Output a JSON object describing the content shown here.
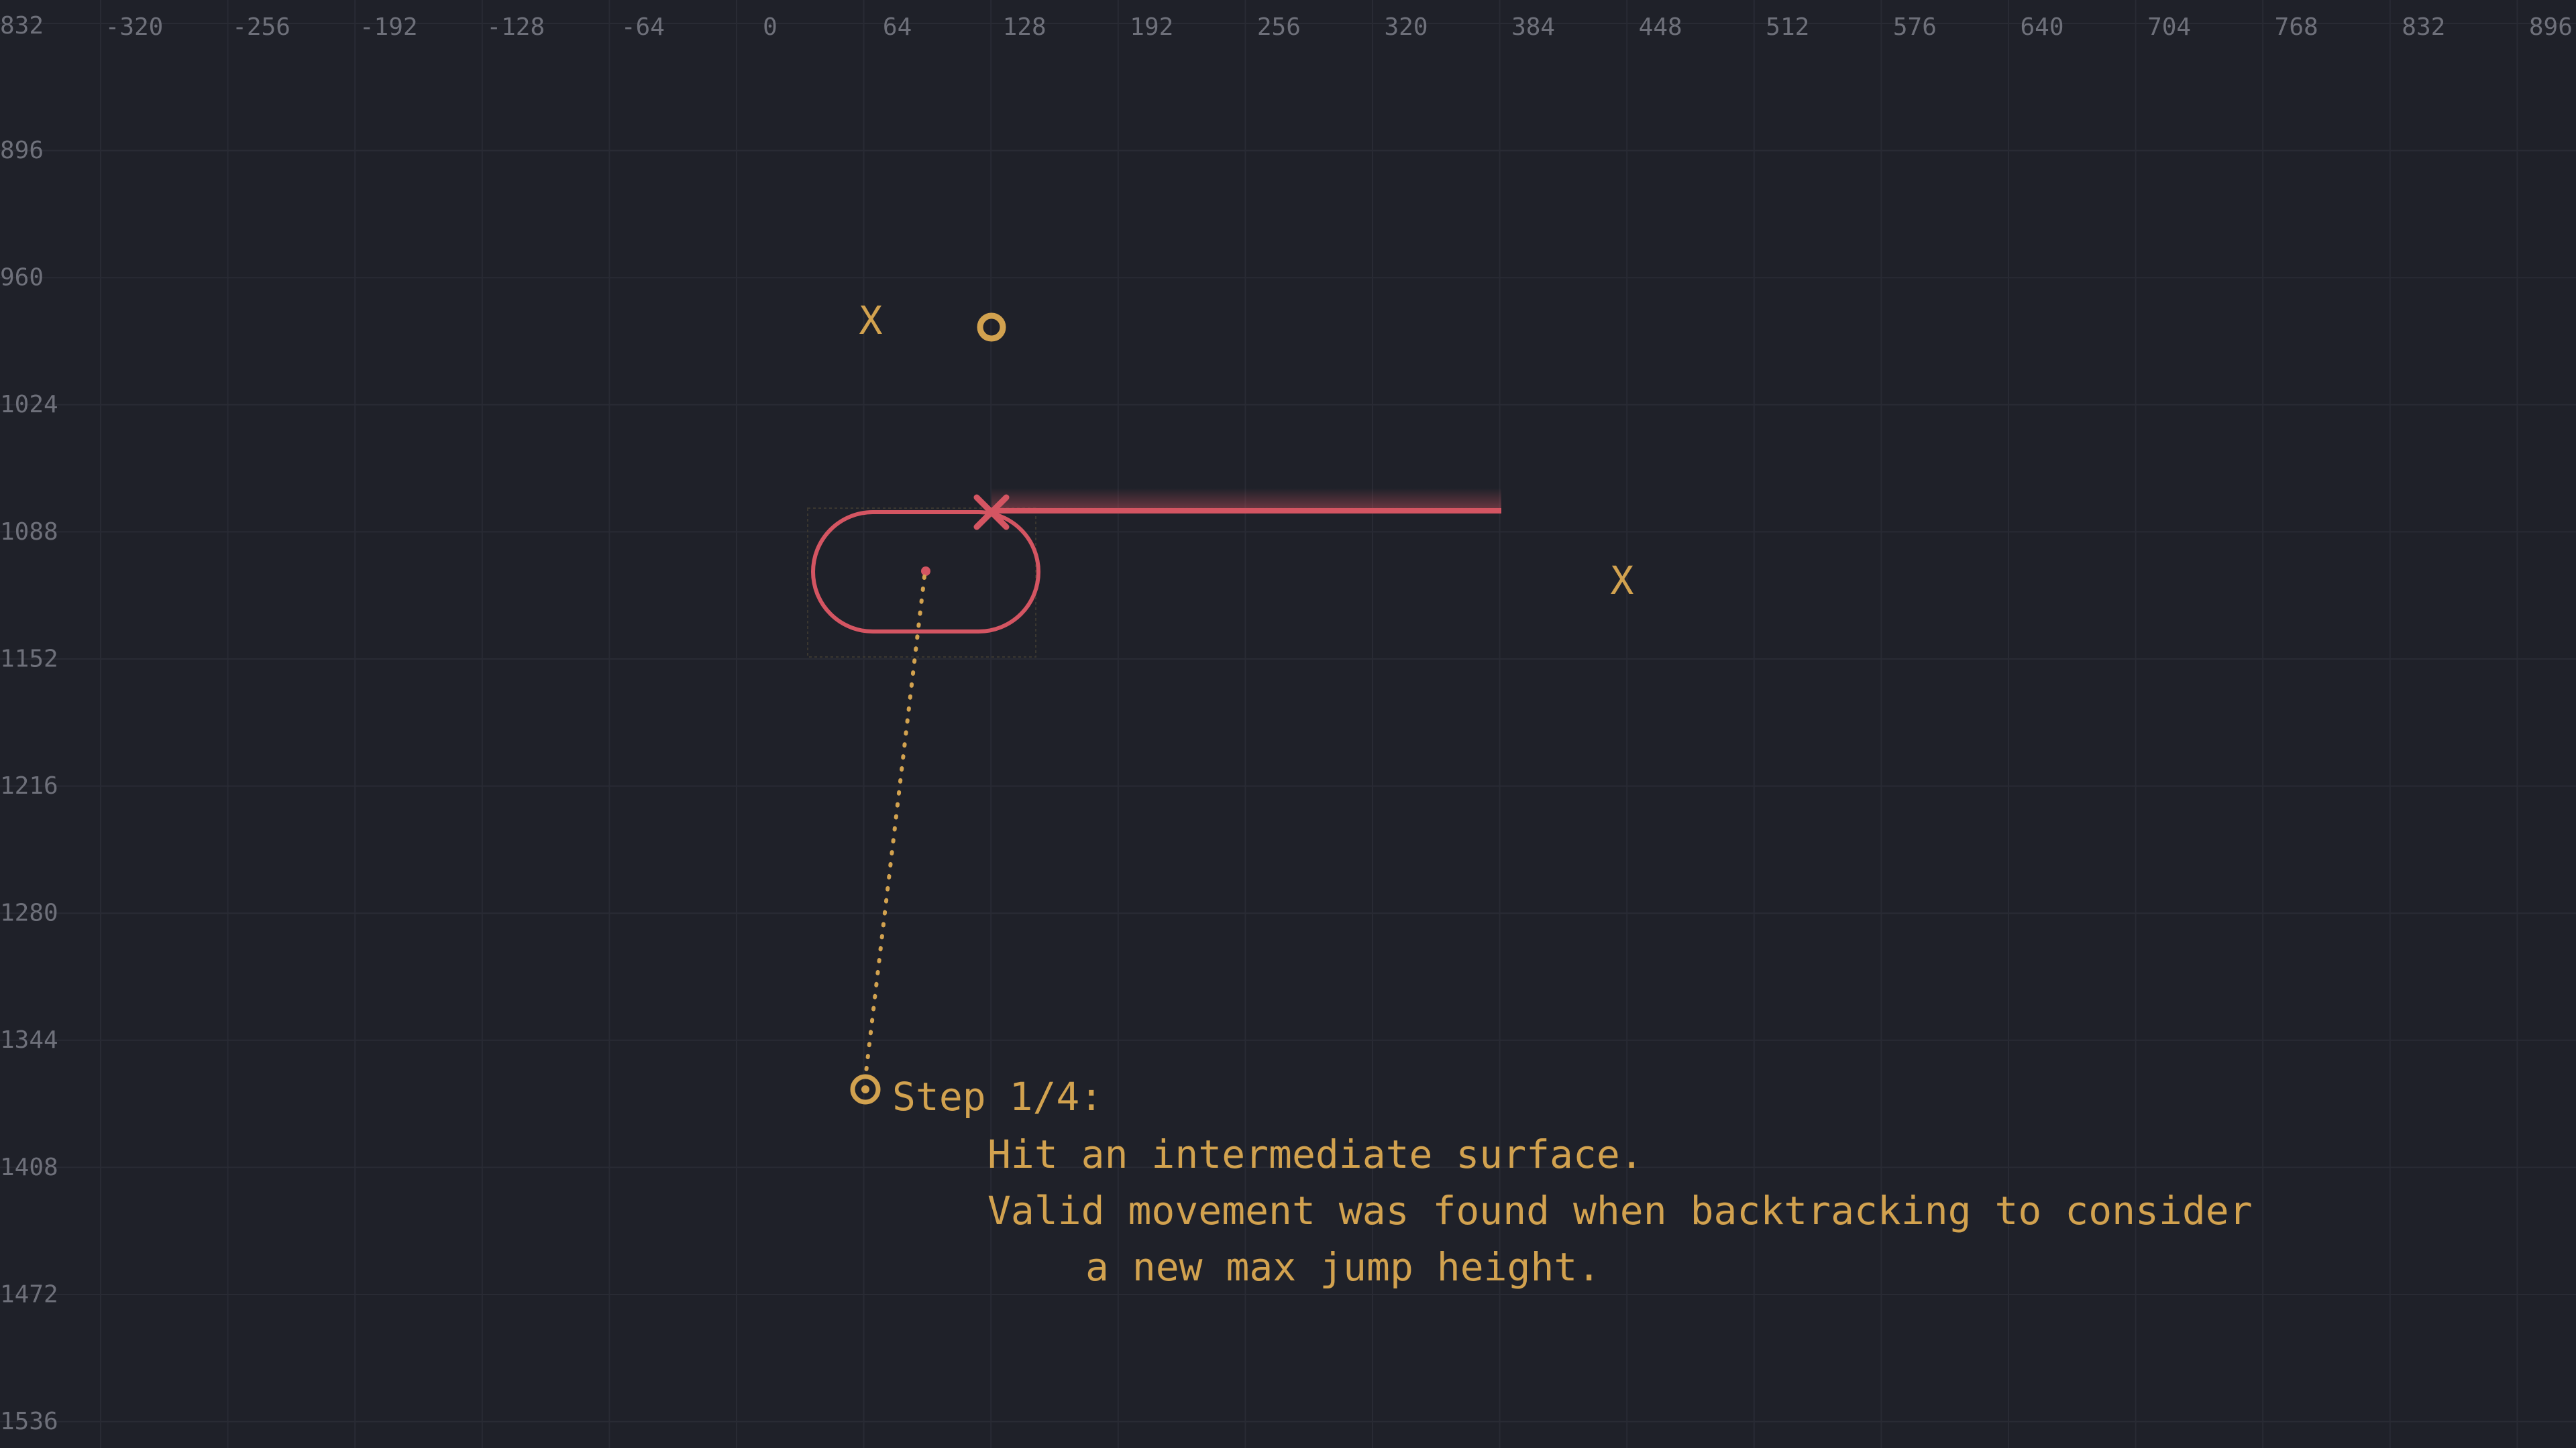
{
  "ruler": {
    "corner_label": "832",
    "x_labels": [
      "-320",
      "-256",
      "-192",
      "-128",
      "-64",
      "0",
      "64",
      "128",
      "192",
      "256",
      "320",
      "384",
      "448",
      "512",
      "576",
      "640",
      "704",
      "768",
      "832",
      "896"
    ],
    "y_labels": [
      "896",
      "960",
      "1024",
      "1088",
      "1152",
      "1216",
      "1280",
      "1344",
      "1408",
      "1472",
      "1536"
    ]
  },
  "markers": {
    "x_glyph": "X",
    "x_left_value": "X",
    "x_right_value": "X"
  },
  "annotation": {
    "step_title": "Step 1/4:",
    "lines": [
      "Hit an intermediate surface.",
      "Valid movement was found when backtracking to consider",
      "a new max jump height."
    ]
  },
  "colors": {
    "background": "#1f2129",
    "grid": "#292b34",
    "ruler_text": "#6e707a",
    "accent_orange": "#d2a24f",
    "accent_red": "#d45562"
  }
}
